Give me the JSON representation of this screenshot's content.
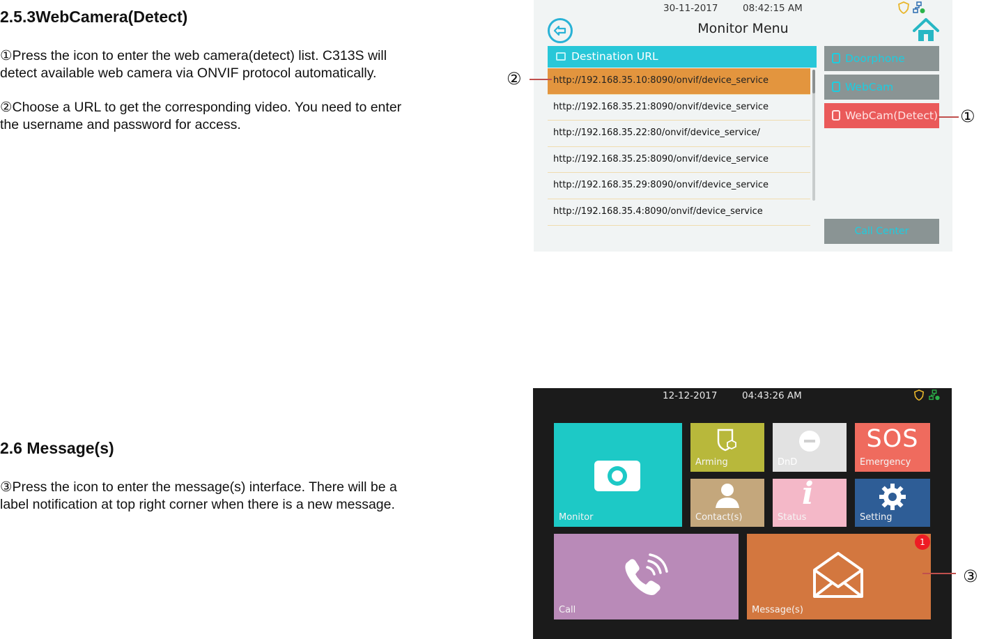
{
  "doc": {
    "section1": {
      "heading": "2.5.3WebCamera(Detect)",
      "para1": "①Press the icon to enter the web camera(detect) list. C313S will detect available web camera via ONVIF protocol automatically.",
      "para2": "②Choose a URL to get the corresponding video. You need to enter the username and password for access."
    },
    "section2": {
      "heading": "2.6 Message(s)",
      "para1": "③Press the icon to enter the message(s) interface. There will be a label notification at top right corner when there is a new message."
    }
  },
  "callouts": {
    "c1": "①",
    "c2": "②",
    "c3": "③"
  },
  "screen1": {
    "date": "30-11-2017",
    "time": "08:42:15  AM",
    "title": "Monitor Menu",
    "list_header": "Destination URL",
    "urls": [
      "http://192.168.35.10:8090/onvif/device_service",
      "http://192.168.35.21:8090/onvif/device_service",
      "http://192.168.35.22:80/onvif/device_service/",
      "http://192.168.35.25:8090/onvif/device_service",
      "http://192.168.35.29:8090/onvif/device_service",
      "http://192.168.35.4:8090/onvif/device_service"
    ],
    "side_buttons": [
      "Doorphone",
      "WebCam",
      "WebCam(Detect)"
    ],
    "call_center": "Call Center",
    "colors": {
      "accent": "#28c7d8",
      "selected": "#e3953e",
      "active": "#ea5a5a",
      "side": "#8a9494"
    },
    "icons": [
      "back-icon",
      "home-icon",
      "shield-icon",
      "network-icon"
    ]
  },
  "screen2": {
    "date": "12-12-2017",
    "time": "04:43:26  AM",
    "tiles": {
      "monitor": "Monitor",
      "arming": "Arming",
      "dnd": "DnD",
      "sos_big": "SOS",
      "emergency": "Emergency",
      "contacts": "Contact(s)",
      "status": "Status",
      "setting": "Setting",
      "call": "Call",
      "messages": "Message(s)"
    },
    "message_badge": "1",
    "colors": {
      "monitor": "#1dc9c6",
      "arming": "#b8b83b",
      "dnd": "#e2e2e2",
      "sos": "#ef6b5e",
      "contacts": "#c4a77c",
      "status": "#f4b8c8",
      "setting": "#2e5d96",
      "call": "#b98ab8",
      "messages": "#d3773f"
    }
  }
}
